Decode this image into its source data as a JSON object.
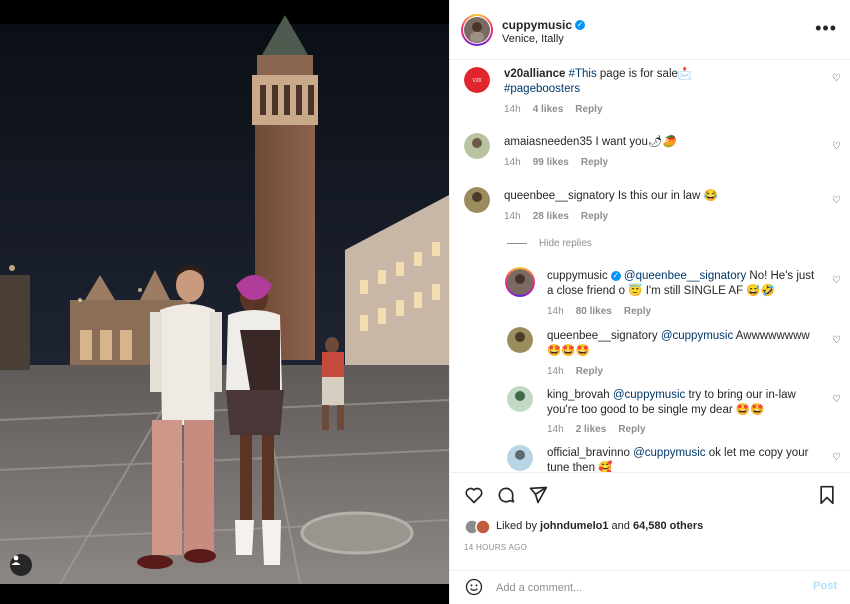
{
  "post": {
    "username": "cuppymusic",
    "location": "Venice, Itally",
    "more_icon": "more-horizontal-icon"
  },
  "comments": [
    {
      "username": "v20alliance",
      "hashtag1": "#This",
      "text": " page is for sale",
      "emoji": "📩",
      "hashtag2": "#pageboosters",
      "time": "14h",
      "likes": "4 likes",
      "reply": "Reply"
    },
    {
      "username": "amaiasneeden35",
      "text": " I want you",
      "emoji": "🌶🥭",
      "time": "14h",
      "likes": "99 likes",
      "reply": "Reply"
    },
    {
      "username": "queenbee__signatory",
      "text": " Is this our in law ",
      "emoji": "😂",
      "time": "14h",
      "likes": "28 likes",
      "reply": "Reply"
    }
  ],
  "hide_replies": "Hide replies",
  "replies": [
    {
      "username": "cuppymusic",
      "mention": "@queenbee__signatory",
      "text": " No! He's just a close friend o 😇 I'm still SINGLE AF 😅🤣",
      "time": "14h",
      "likes": "80 likes",
      "reply": "Reply"
    },
    {
      "username": "queenbee__signatory",
      "mention": "@cuppymusic",
      "text": " Awwwwwwww 🤩🤩🤩",
      "time": "14h",
      "reply": "Reply"
    },
    {
      "username": "king_brovah",
      "mention": "@cuppymusic",
      "text": " try to bring our in-law you're too good to be single my dear 🤩🤩",
      "time": "14h",
      "likes": "2 likes",
      "reply": "Reply"
    },
    {
      "username": "official_bravinno",
      "mention": "@cuppymusic",
      "text": " ok let me copy your tune then 🥰"
    }
  ],
  "actions": {
    "liked_by_prefix": "Liked by ",
    "liked_by_user": "johndumelo1",
    "liked_by_and": " and ",
    "liked_by_count": "64,580 others",
    "time_ago": "14 HOURS AGO"
  },
  "comment_box": {
    "placeholder": "Add a comment...",
    "post_label": "Post"
  },
  "colors": {
    "link": "#00376b",
    "muted": "#8e8e8e",
    "verified": "#0095f6",
    "post_disabled": "#b2dffc"
  }
}
